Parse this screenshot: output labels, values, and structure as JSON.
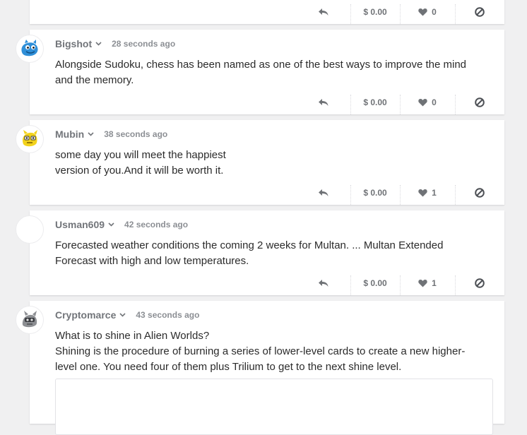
{
  "posts": [
    {
      "username": "",
      "time": "",
      "lines": [],
      "amount": "$ 0.00",
      "likes": "0"
    },
    {
      "username": "Bigshot",
      "time": "28 seconds ago",
      "lines": [
        "Alongside Sudoku, chess has been named as one of the best ways to improve the mind",
        "and the memory."
      ],
      "amount": "$ 0.00",
      "likes": "0"
    },
    {
      "username": "Mubin",
      "time": "38 seconds ago",
      "lines": [
        "some day you will meet the happiest",
        "version of you.And it will be worth it."
      ],
      "amount": "$ 0.00",
      "likes": "1"
    },
    {
      "username": "Usman609",
      "time": "42 seconds ago",
      "lines": [
        "Forecasted weather conditions the coming 2 weeks for Multan. ... Multan Extended",
        "Forecast with high and low temperatures."
      ],
      "amount": "$ 0.00",
      "likes": "1"
    },
    {
      "username": "Cryptomarce",
      "time": "43 seconds ago",
      "lines": [
        "What is to shine in Alien Worlds?",
        "Shining is the procedure of burning a series of lower-level cards to create a new higher-",
        "level one. You need four of them plus Trilium to get to the next shine level."
      ]
    }
  ],
  "colors": {
    "background": "#f0f0f1",
    "card": "#ffffff",
    "username": "#72757a",
    "time": "#8c8f94",
    "icon": "#6f7276"
  },
  "icons": {
    "reply": "reply-arrow-icon",
    "like": "heart-icon",
    "flag": "block-icon",
    "caret": "chevron-down-icon"
  }
}
